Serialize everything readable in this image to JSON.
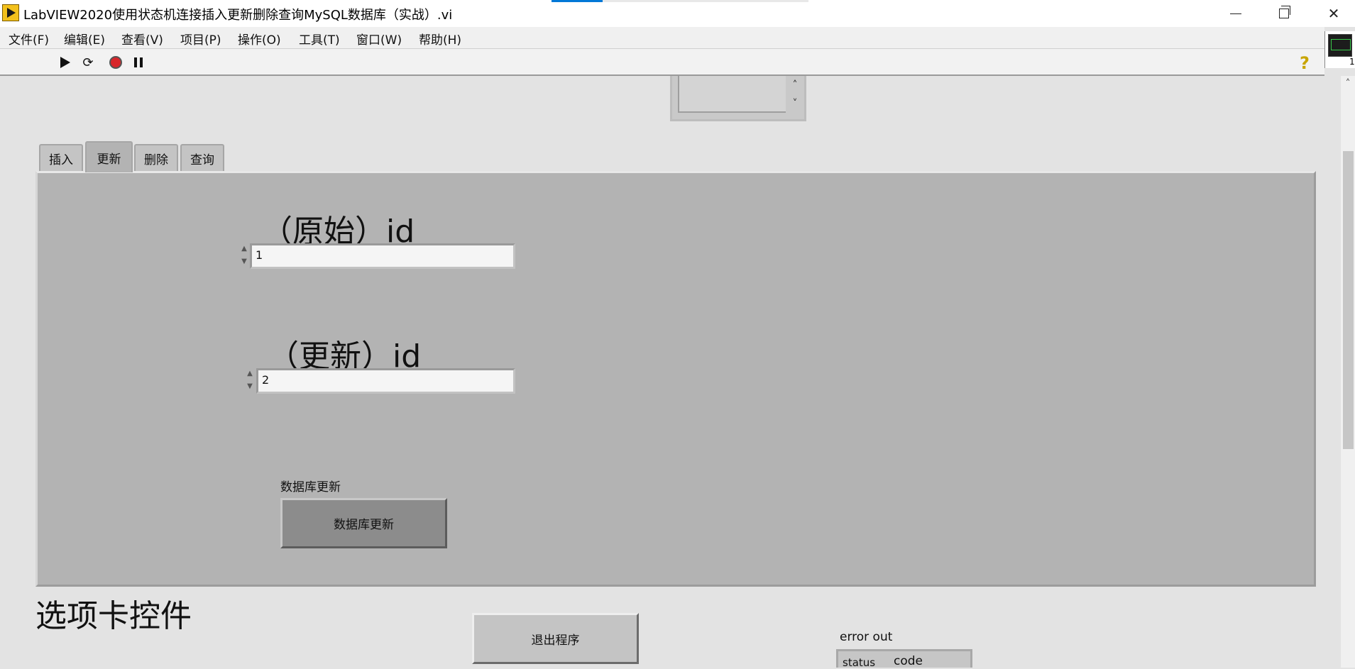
{
  "window": {
    "title": "LabVIEW2020使用状态机连接插入更新删除查询MySQL数据库（实战）.vi"
  },
  "menu": {
    "items": [
      "文件(F)",
      "编辑(E)",
      "查看(V)",
      "项目(P)",
      "操作(O)",
      "工具(T)",
      "窗口(W)",
      "帮助(H)"
    ]
  },
  "toolbar": {
    "icons": [
      "run-arrow-icon",
      "run-continuously-icon",
      "abort-execution-icon",
      "pause-icon"
    ],
    "help": "?"
  },
  "vi_icon": {
    "label": "1"
  },
  "tabs": {
    "items": [
      "插入",
      "更新",
      "删除",
      "查询"
    ],
    "active": "更新"
  },
  "update_tab": {
    "original_id_label": "（原始）id",
    "original_id_value": "1",
    "new_id_label": "（更新）id",
    "new_id_value": "2",
    "db_update_caption": "数据库更新",
    "db_update_button": "数据库更新"
  },
  "front_panel": {
    "tab_control_caption": "选项卡控件",
    "exit_button": "退出程序",
    "error_out_label": "error out",
    "error_status": "status",
    "error_code": "code"
  },
  "colors": {
    "panel_bg": "#e3e3e3",
    "tab_body": "#b3b3b3",
    "stop_red": "#d8262b",
    "help_yellow": "#c8a500"
  }
}
